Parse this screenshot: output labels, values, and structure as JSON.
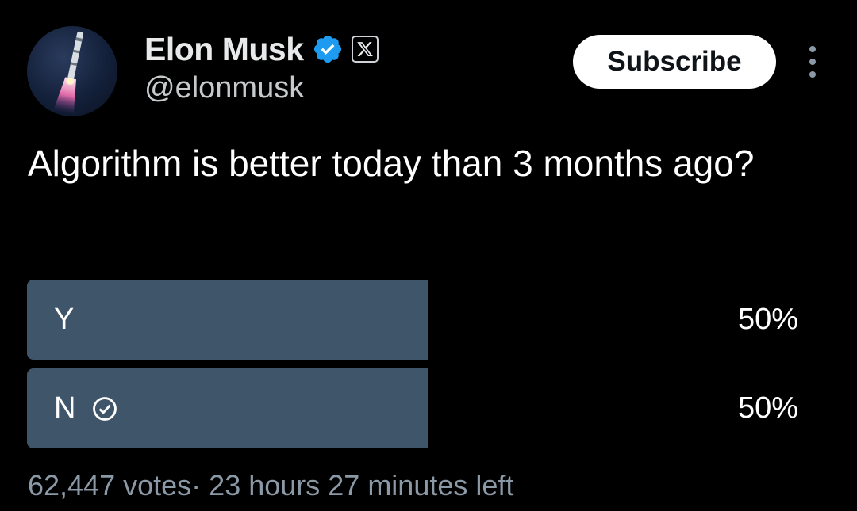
{
  "author": {
    "display_name": "Elon Musk",
    "handle": "@elonmusk",
    "verified_icon": "verified-badge-icon",
    "affiliation_icon": "x-logo-icon"
  },
  "actions": {
    "subscribe_label": "Subscribe",
    "more_icon": "more-options-icon"
  },
  "tweet": {
    "text": "Algorithm is better today than 3 months ago?"
  },
  "poll": {
    "options": [
      {
        "label": "Y",
        "percent_text": "50%",
        "percent": 50,
        "voted": false
      },
      {
        "label": "N",
        "percent_text": "50%",
        "percent": 50,
        "voted": true
      }
    ],
    "votes_text": "62,447 votes",
    "separator": "·",
    "time_left": "23 hours 27 minutes left"
  },
  "colors": {
    "background": "#000000",
    "bar": "#3f5569",
    "verified": "#1d9bf0",
    "muted": "#8b98a5"
  }
}
